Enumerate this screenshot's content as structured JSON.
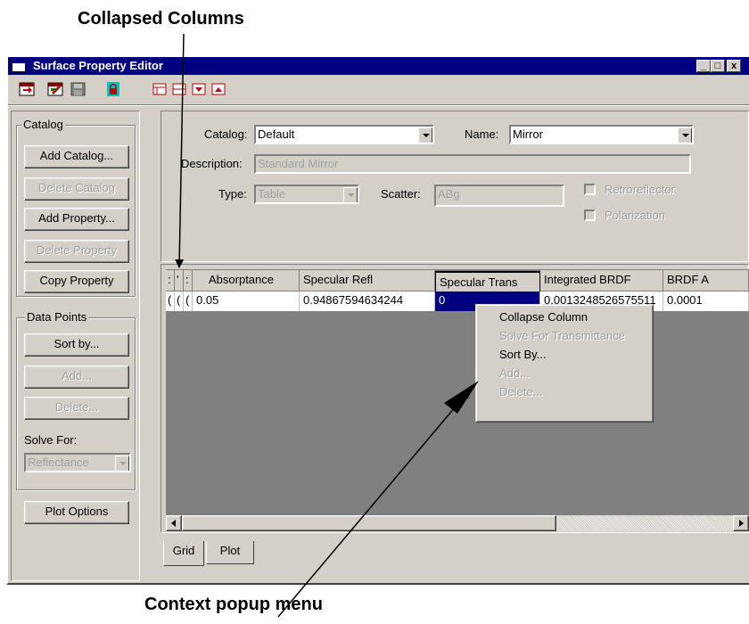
{
  "callouts": {
    "top": "Collapsed Columns",
    "bottom": "Context popup menu"
  },
  "window": {
    "title": "Surface Property Editor",
    "controls": {
      "minimize": "_",
      "maximize": "□",
      "close": "x"
    }
  },
  "toolbar": {
    "icons": [
      "open-icon",
      "save-as-icon",
      "save-icon",
      "lock-icon",
      "view-grid-icon",
      "view-split-icon",
      "expand-down-icon",
      "expand-up-icon"
    ]
  },
  "catalog_group": {
    "label": "Catalog",
    "add_catalog": "Add Catalog...",
    "delete_catalog": "Delete Catalog",
    "add_property": "Add Property...",
    "delete_property": "Delete Property",
    "copy_property": "Copy Property"
  },
  "data_points_group": {
    "label": "Data Points",
    "sort_by": "Sort by...",
    "add": "Add...",
    "delete": "Delete...",
    "solve_for_label": "Solve For:",
    "solve_for_value": "Reflectance"
  },
  "plot_options": "Plot Options",
  "form": {
    "catalog_label": "Catalog:",
    "catalog_value": "Default",
    "name_label": "Name:",
    "name_value": "Mirror",
    "description_label": "Description:",
    "description_value": "Standard Mirror",
    "type_label": "Type:",
    "type_value": "Table",
    "scatter_label": "Scatter:",
    "scatter_value": "ABg",
    "retroreflector_label": "Retroreflector",
    "polarization_label": "Polarization"
  },
  "grid": {
    "collapsed_headers": [
      ":",
      "'",
      ":"
    ],
    "collapsed_cells": [
      "(",
      "(",
      "("
    ],
    "columns": [
      "Absorptance",
      "Specular Refl",
      "Specular Trans",
      "Integrated BRDF",
      "BRDF A"
    ],
    "row": [
      "0.05",
      "0.94867594634244",
      "0",
      "0.0013248526575511",
      "0.0001"
    ],
    "selected_column": "Specular Trans"
  },
  "context_menu": {
    "items": [
      {
        "label": "Collapse Column",
        "enabled": true
      },
      {
        "label": "Solve For Transmittance",
        "enabled": false
      },
      {
        "label": "Sort By...",
        "enabled": true
      },
      {
        "label": "Add...",
        "enabled": false
      },
      {
        "label": "Delete...",
        "enabled": false
      }
    ]
  },
  "tabs": [
    "Grid",
    "Plot"
  ],
  "colors": {
    "titlebar": "#000080",
    "face": "#d4d0c8",
    "selection": "#000080",
    "grid_background": "#808080"
  }
}
